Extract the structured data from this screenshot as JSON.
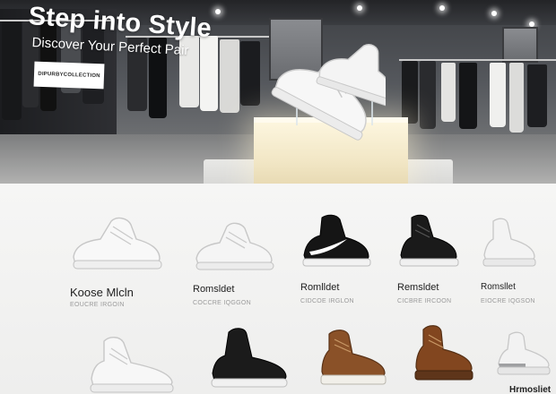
{
  "hero": {
    "title": "Step into Style",
    "subtitle": "Discover Your Perfect Pair",
    "cta_label": "DIPURBYCOLLECTION"
  },
  "colors": {
    "page_background": "#f1f1f0",
    "hero_text": "#ffffff",
    "cta_background": "#ffffff",
    "product_name": "#222222",
    "product_meta": "#9a9a9a"
  },
  "products": [
    {
      "name": "Koose Mlcln",
      "meta": "EOUCRE IRGOIN",
      "style": "white-low-top"
    },
    {
      "name": "Romsldet",
      "meta": "COCCRE IQGGON",
      "style": "white-low-top"
    },
    {
      "name": "Romlldet",
      "meta": "CIDCOE IRGLON",
      "style": "black-white-swoosh"
    },
    {
      "name": "Remsldet",
      "meta": "CICBRE IRCOON",
      "style": "black-high-top"
    },
    {
      "name": "Romsllet",
      "meta": "EIOCRE IQGSON",
      "style": "white-high-top"
    },
    {
      "name": "",
      "meta": "",
      "style": "white-high-top"
    },
    {
      "name": "",
      "meta": "",
      "style": "black-low-top"
    },
    {
      "name": "",
      "meta": "",
      "style": "brown-boot"
    },
    {
      "name": "",
      "meta": "",
      "style": "brown-boot"
    },
    {
      "name": "Hrmosliet",
      "meta": "",
      "style": "white-grey-high-top"
    }
  ]
}
